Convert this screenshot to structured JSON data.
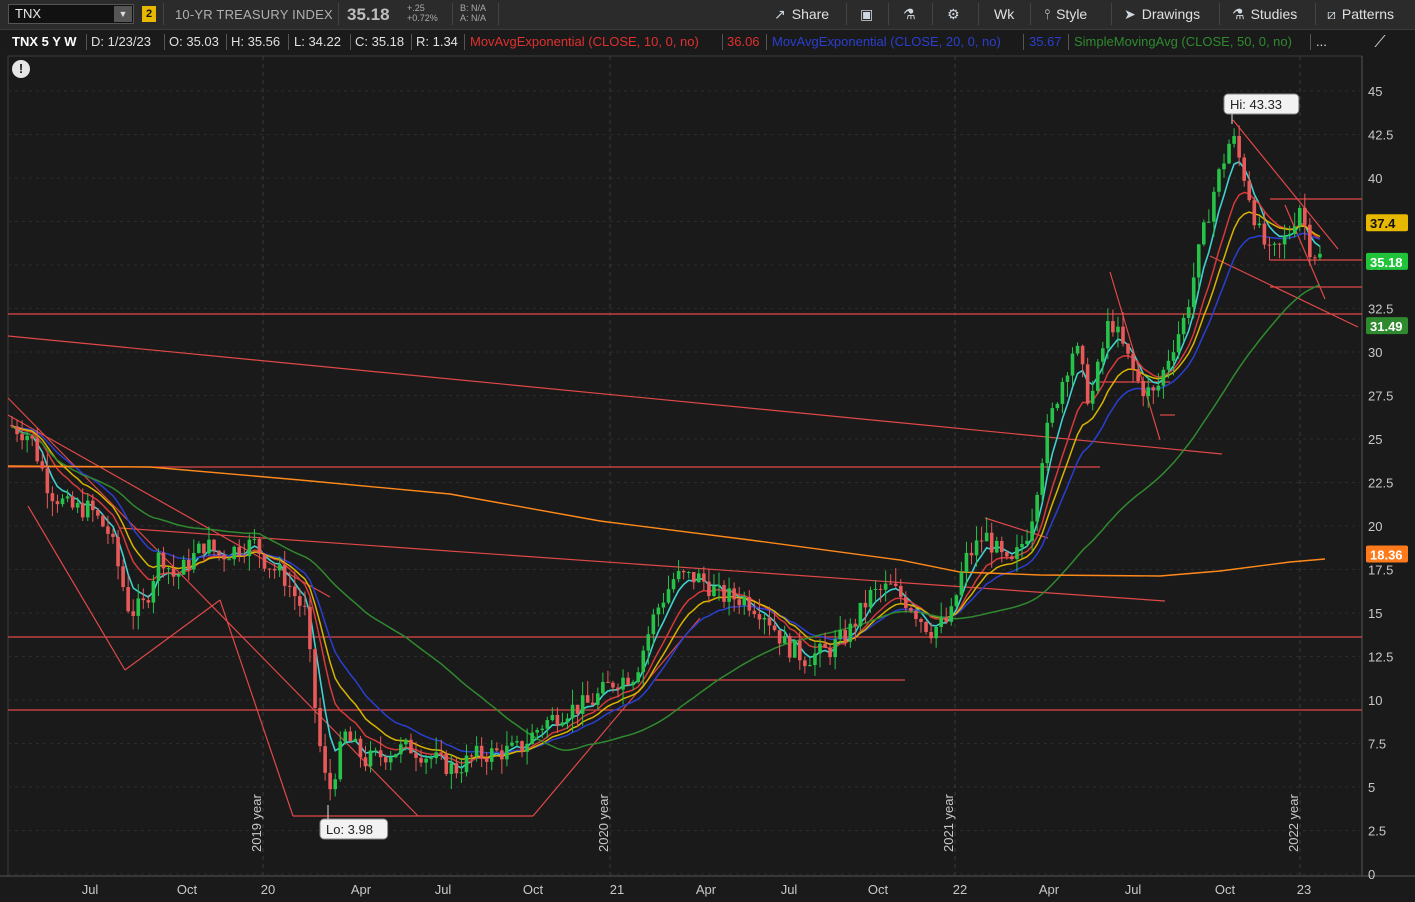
{
  "toolbar": {
    "symbol": "TNX",
    "link_number": "2",
    "description": "10-YR TREASURY INDEX",
    "last_price": "35.18",
    "net_change": "+.25",
    "percent_change": "+0.72%",
    "bid": "B: N/A",
    "ask": "A: N/A",
    "share_label": "Share",
    "timeframe_label": "Wk",
    "style_label": "Style",
    "drawings_label": "Drawings",
    "studies_label": "Studies",
    "patterns_label": "Patterns"
  },
  "studybar": {
    "symbol_period": "TNX 5 Y W",
    "date": "D: 1/23/23",
    "open": "O: 35.03",
    "high": "H: 35.56",
    "low": "L: 34.22",
    "close": "C: 35.18",
    "range": "R: 1.34",
    "study1_name": "MovAvgExponential (CLOSE, 10, 0, no)",
    "study1_value": "36.06",
    "study2_name": "MovAvgExponential (CLOSE, 20, 0, no)",
    "study2_value": "35.67",
    "study3_name": "SimpleMovingAvg (CLOSE, 50, 0, no)",
    "more": "...",
    "colors": {
      "ema10": "#e03030",
      "ema20": "#2a3fd0",
      "sma50": "#2f8a2f"
    }
  },
  "chart": {
    "hi_label": "Hi: 43.33",
    "lo_label": "Lo: 3.98",
    "price_tags": [
      "37.4",
      "35.18",
      "31.49",
      "18.36"
    ],
    "price_tag_colors": [
      "#e6b800",
      "#21c33a",
      "#2f8a2f",
      "#ff7a1a"
    ],
    "y_ticks": [
      "45",
      "42.5",
      "40",
      "37.5",
      "35",
      "32.5",
      "30",
      "27.5",
      "25",
      "22.5",
      "20",
      "17.5",
      "15",
      "12.5",
      "10",
      "7.5",
      "5",
      "2.5",
      "0"
    ],
    "x_ticks": [
      "Jul",
      "Oct",
      "20",
      "Apr",
      "Jul",
      "Oct",
      "21",
      "Apr",
      "Jul",
      "Oct",
      "22",
      "Apr",
      "Jul",
      "Oct",
      "23"
    ],
    "year_labels": [
      "2019 year",
      "2020 year",
      "2021 year",
      "2022 year"
    ]
  }
}
